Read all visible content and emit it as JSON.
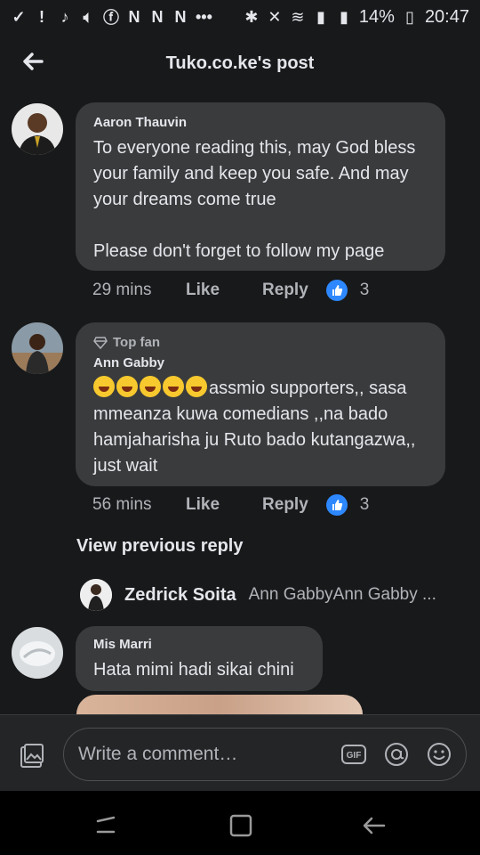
{
  "status_bar": {
    "battery": "14%",
    "time": "20:47"
  },
  "header": {
    "title": "Tuko.co.ke's post"
  },
  "comments": [
    {
      "author": "Aaron Thauvin",
      "text": "To everyone reading this, may God bless your family and keep you safe. And may your dreams come true\n\nPlease don't forget to follow my page",
      "time": "29 mins",
      "like_label": "Like",
      "reply_label": "Reply",
      "reactions": "3"
    },
    {
      "badge": "Top fan",
      "author": "Ann Gabby",
      "text": "assmio supporters,, sasa mmeanza kuwa comedians ,,na bado hamjaharisha ju Ruto bado kutangazwa,, just wait",
      "time": "56 mins",
      "like_label": "Like",
      "reply_label": "Reply",
      "reactions": "3"
    },
    {
      "author": "Mis Marri",
      "text": "Hata mimi hadi sikai chini"
    }
  ],
  "view_previous_reply": "View previous reply",
  "reply_preview": {
    "author": "Zedrick Soita",
    "text": "Ann GabbyAnn Gabby ..."
  },
  "composer": {
    "placeholder": "Write a comment…"
  },
  "icons": {
    "back": "arrow-left-icon",
    "photo": "photo-icon",
    "gif": "gif-icon",
    "mention": "at-icon",
    "emoji": "smiley-icon",
    "like": "thumbs-up-icon"
  },
  "colors": {
    "background": "#18191a",
    "bubble": "#3a3b3c",
    "like_blue": "#2d88ff"
  }
}
